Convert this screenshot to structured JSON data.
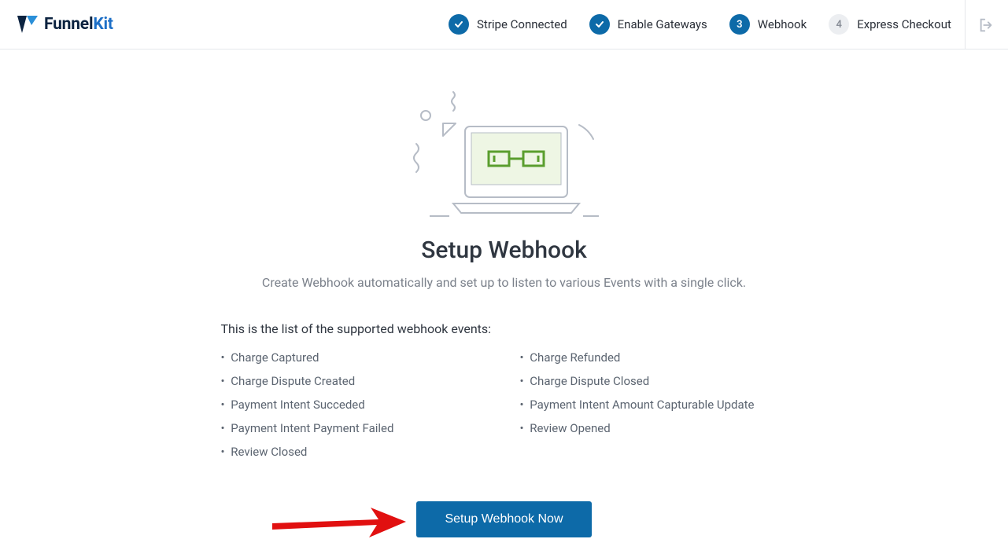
{
  "logo": {
    "name": "FunnelKit"
  },
  "steps": [
    {
      "state": "done",
      "mark": "✓",
      "label": "Stripe Connected"
    },
    {
      "state": "done",
      "mark": "✓",
      "label": "Enable Gateways"
    },
    {
      "state": "current",
      "mark": "3",
      "label": "Webhook"
    },
    {
      "state": "pending",
      "mark": "4",
      "label": "Express Checkout"
    }
  ],
  "main": {
    "title": "Setup Webhook",
    "subtitle": "Create Webhook automatically and set up to listen to various Events with a single click.",
    "intro": "This is the list of the supported webhook events:",
    "events_left": [
      "Charge Captured",
      "Charge Dispute Created",
      "Payment Intent Succeded",
      "Payment Intent Payment Failed",
      "Review Closed"
    ],
    "events_right": [
      "Charge Refunded",
      "Charge Dispute Closed",
      "Payment Intent Amount Capturable Update",
      "Review Opened"
    ],
    "button": "Setup Webhook Now"
  }
}
